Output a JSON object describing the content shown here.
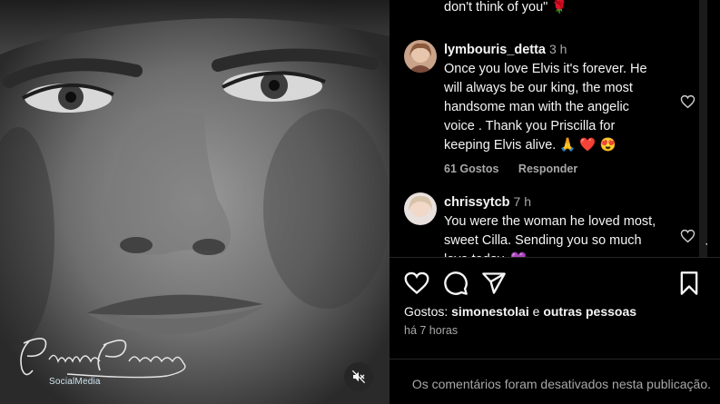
{
  "media": {
    "watermark_signature": "Priscilla Presley",
    "watermark_sub": "SocialMedia",
    "mute_icon": "speaker-muted-icon"
  },
  "comments": {
    "previous_tail": "don't think of you\" 🌹",
    "items": [
      {
        "username": "lymbouris_detta",
        "time": "3 h",
        "text": "Once you love Elvis it's forever. He will always be our king, the most handsome man with the angelic voice . Thank you Priscilla for keeping Elvis alive. 🙏 ❤️ 😍",
        "likes": "61 Gostos",
        "reply": "Responder"
      },
      {
        "username": "chrissytcb",
        "time": "7 h",
        "text": "You were the woman he loved most, sweet Cilla. Sending you so much love today. 💜"
      }
    ]
  },
  "actions": {
    "like_icon": "heart-icon",
    "comment_icon": "comment-icon",
    "share_icon": "send-icon",
    "save_icon": "bookmark-icon"
  },
  "likes": {
    "prefix": "Gostos:",
    "user": "simonestolai",
    "joiner": "e",
    "others": "outras pessoas"
  },
  "posted": "há 7 horas",
  "comments_disabled": "Os comentários foram desativados nesta publicação.",
  "colors": {
    "background": "#000000",
    "text": "#f5f5f5",
    "secondary": "#a8a8a8",
    "divider": "#262626"
  }
}
